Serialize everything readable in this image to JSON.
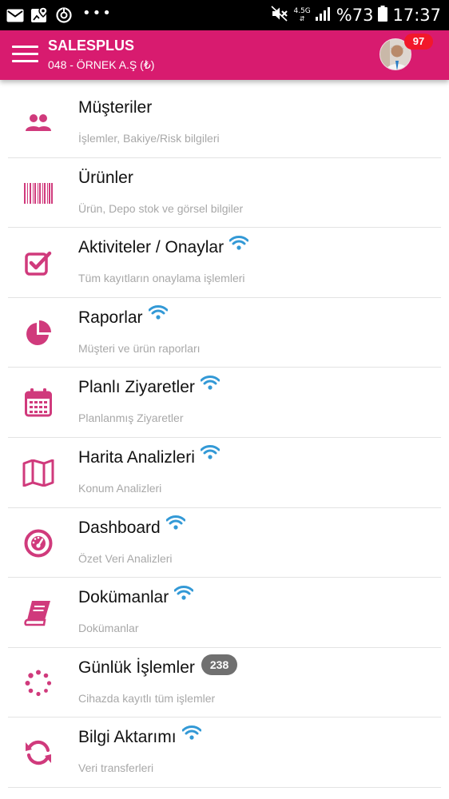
{
  "status_bar": {
    "network": "4.5G",
    "battery": "%73",
    "time": "17:37",
    "left_icons": [
      "mail-icon",
      "map-marker-icon",
      "clock-icon",
      "more-dots-icon"
    ]
  },
  "header": {
    "title": "SALESPLUS",
    "subtitle": "048 - ÖRNEK A.Ş (₺)",
    "notification_count": "97",
    "accent_color": "#d81b6f"
  },
  "menu": {
    "items": [
      {
        "title": "Müşteriler",
        "subtitle": "İşlemler, Bakiye/Risk bilgileri",
        "icon": "users-icon",
        "wifi": false
      },
      {
        "title": "Ürünler",
        "subtitle": "Ürün, Depo stok ve görsel bilgiler",
        "icon": "barcode-icon",
        "wifi": false
      },
      {
        "title": "Aktiviteler / Onaylar",
        "subtitle": "Tüm kayıtların onaylama işlemleri",
        "icon": "check-square-icon",
        "wifi": true
      },
      {
        "title": "Raporlar",
        "subtitle": "Müşteri ve ürün raporları",
        "icon": "pie-chart-icon",
        "wifi": true
      },
      {
        "title": "Planlı Ziyaretler",
        "subtitle": "Planlanmış Ziyaretler",
        "icon": "calendar-icon",
        "wifi": true
      },
      {
        "title": "Harita Analizleri",
        "subtitle": "Konum Analizleri",
        "icon": "map-icon",
        "wifi": true
      },
      {
        "title": "Dashboard",
        "subtitle": "Özet Veri Analizleri",
        "icon": "dashboard-gauge-icon",
        "wifi": true
      },
      {
        "title": "Dokümanlar",
        "subtitle": "Dokümanlar",
        "icon": "book-icon",
        "wifi": true
      },
      {
        "title": "Günlük İşlemler",
        "subtitle": "Cihazda kayıtlı tüm işlemler",
        "icon": "spinner-icon",
        "wifi": false,
        "badge": "238"
      },
      {
        "title": "Bilgi Aktarımı",
        "subtitle": "Veri transferleri",
        "icon": "sync-icon",
        "wifi": true
      }
    ]
  }
}
